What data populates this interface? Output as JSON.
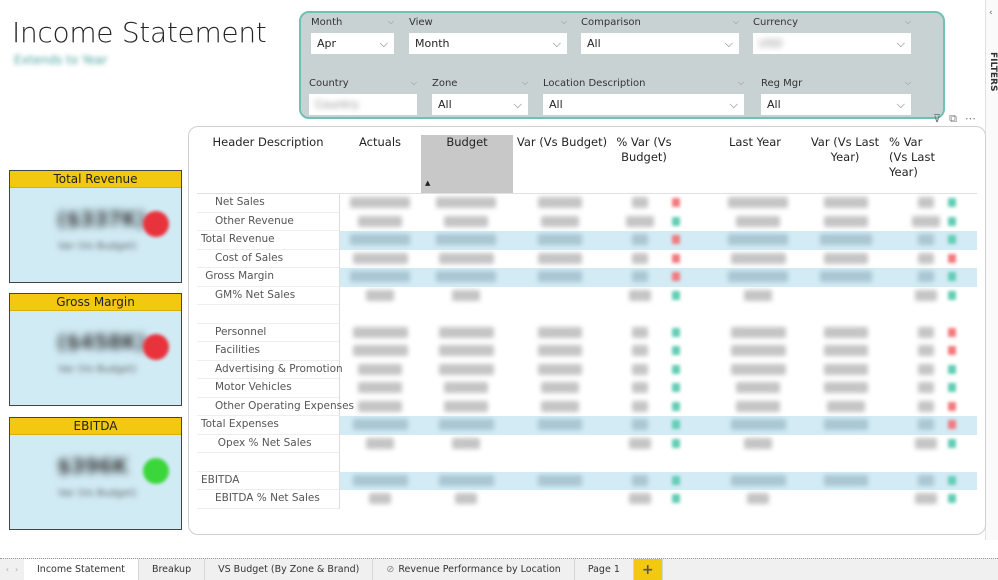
{
  "page": {
    "title": "Income Statement",
    "subtitle": "Extends to Year"
  },
  "slicers": [
    {
      "label": "Month",
      "value": "Apr"
    },
    {
      "label": "View",
      "value": "Month"
    },
    {
      "label": "Comparison",
      "value": "All"
    },
    {
      "label": "Currency",
      "value": "USD",
      "redacted": true
    },
    {
      "label": "Country",
      "value": "Country",
      "redacted": true
    },
    {
      "label": "Zone",
      "value": "All"
    },
    {
      "label": "Location Description",
      "value": "All"
    },
    {
      "label": "Reg Mgr",
      "value": "All"
    }
  ],
  "visual_header": {
    "filter_icon": "filter-icon",
    "focus_icon": "focus-mode-icon",
    "more_icon": "more-options-icon"
  },
  "filters_pane": {
    "label": "FILTERS"
  },
  "kpi_cards": [
    {
      "title": "Total Revenue",
      "value": "($337K)",
      "sub": "Var (Vs Budget)",
      "status": "negative",
      "status_color": "#e8323c"
    },
    {
      "title": "Gross Margin",
      "value": "($458K)",
      "sub": "Var (Vs Budget)",
      "status": "negative",
      "status_color": "#e8323c"
    },
    {
      "title": "EBITDA",
      "value": "$396K",
      "sub": "Var (Vs Budget)",
      "status": "positive",
      "status_color": "#3ad63a"
    }
  ],
  "matrix": {
    "columns": [
      "Header Description",
      "Actuals",
      "Budget",
      "Var (Vs Budget)",
      "% Var (Vs Budget)",
      "Last Year",
      "Var (Vs Last Year)",
      "% Var (Vs Last Year)"
    ],
    "sorted_column": "Budget",
    "sort_direction": "ascending",
    "rows": [
      {
        "label": "Net Sales",
        "level": 1,
        "highlight": false,
        "vals": [
          "$XX,XXX,XXX",
          "$XX,XXX,XXX",
          "$XXX,XXX",
          "X%",
          "$XX,XXX,XXX",
          "$XXX,XXX",
          "X%"
        ],
        "ind_budget": "down",
        "ind_ly": "up"
      },
      {
        "label": "Other Revenue",
        "level": 1,
        "highlight": false,
        "vals": [
          "$XXX,XXX",
          "$XXX,XXX",
          "$XX,XXX",
          "XX.X%",
          "$XXX,XXX",
          "$XXX,XXX",
          "XX.X%"
        ],
        "ind_budget": "up",
        "ind_ly": "up"
      },
      {
        "label": "Total Revenue",
        "level": 0,
        "highlight": true,
        "vals": [
          "$XX,XXX,XXX",
          "$XX,XXX,XXX",
          "$XXX,XXX",
          "X%",
          "$XX,XXX,XXX",
          "$X,XXX,XXX",
          "X%"
        ],
        "ind_budget": "down",
        "ind_ly": "up"
      },
      {
        "label": "Cost of Sales",
        "level": 1,
        "highlight": false,
        "vals": [
          "$X,XXX,XXX",
          "$X,XXX,XXX",
          "$XXX,XXX",
          "X%",
          "$X,XXX,XXX",
          "$XXX,XXX",
          "X%"
        ],
        "ind_budget": "down",
        "ind_ly": "down"
      },
      {
        "label": "Gross Margin",
        "level": 0.3,
        "highlight": true,
        "vals": [
          "$XX,XXX,XXX",
          "$XX,XXX,XXX",
          "$XXX,XXX",
          "X%",
          "$XX,XXX,XXX",
          "$X,XXX,XXX",
          "X%"
        ],
        "ind_budget": "down",
        "ind_ly": "up"
      },
      {
        "label": "GM% Net Sales",
        "level": 1,
        "highlight": false,
        "vals": [
          "XX.X%",
          "XX.X%",
          "",
          "X.X%",
          "XX.X%",
          "",
          "X.X%"
        ],
        "ind_budget": "up",
        "ind_ly": "up"
      },
      {
        "label": "",
        "level": 1,
        "highlight": false,
        "vals": [
          "",
          "",
          "",
          "",
          "",
          "",
          ""
        ],
        "ind_budget": "",
        "ind_ly": ""
      },
      {
        "label": "Personnel",
        "level": 1,
        "highlight": false,
        "vals": [
          "$X,XXX,XXX",
          "$X,XXX,XXX",
          "$XXX,XXX",
          "X%",
          "$X,XXX,XXX",
          "$XXX,XXX",
          "X%"
        ],
        "ind_budget": "up",
        "ind_ly": "down"
      },
      {
        "label": "Facilities",
        "level": 1,
        "highlight": false,
        "vals": [
          "$X,XXX,XXX",
          "$X,XXX,XXX",
          "$XXX,XXX",
          "X%",
          "$X,XXX,XXX",
          "$XXX,XXX",
          "X%"
        ],
        "ind_budget": "up",
        "ind_ly": "down"
      },
      {
        "label": "Advertising & Promotion",
        "level": 1,
        "highlight": false,
        "vals": [
          "$XXX,XXX",
          "$X,XXX,XXX",
          "$XXX,XXX",
          "XX%",
          "$X,XXX,XXX",
          "$XXX,XXX",
          "XX%"
        ],
        "ind_budget": "up",
        "ind_ly": "up"
      },
      {
        "label": "Motor Vehicles",
        "level": 1,
        "highlight": false,
        "vals": [
          "$XXX,XXX",
          "$XXX,XXX",
          "$XX,XXX",
          "XX%",
          "$XXX,XXX",
          "$XXX,XXX",
          "XX%"
        ],
        "ind_budget": "up",
        "ind_ly": "up"
      },
      {
        "label": "Other Operating Expenses",
        "level": 1,
        "highlight": false,
        "vals": [
          "$XXX,XXX",
          "$XXX,XXX",
          "$XX,XXX",
          "X%",
          "$XXX,XXX",
          "$XX,XXX",
          "X%"
        ],
        "ind_budget": "up",
        "ind_ly": "down"
      },
      {
        "label": "Total Expenses",
        "level": 0,
        "highlight": true,
        "vals": [
          "$X,XXX,XXX",
          "$X,XXX,XXX",
          "$XXX,XXX",
          "X%",
          "$X,XXX,XXX",
          "$XXX,XXX",
          "X%"
        ],
        "ind_budget": "up",
        "ind_ly": "down"
      },
      {
        "label": "Opex % Net Sales",
        "level": 1.2,
        "highlight": false,
        "vals": [
          "XX.X%",
          "XX.X%",
          "",
          "X.X%",
          "XX.X%",
          "",
          "X.X%"
        ],
        "ind_budget": "up",
        "ind_ly": "up"
      },
      {
        "label": "",
        "level": 1,
        "highlight": false,
        "vals": [
          "",
          "",
          "",
          "",
          "",
          "",
          ""
        ],
        "ind_budget": "",
        "ind_ly": ""
      },
      {
        "label": "EBITDA",
        "level": 0,
        "highlight": true,
        "vals": [
          "$X,XXX,XXX",
          "$X,XXX,XXX",
          "$XXX,XXX",
          "X%",
          "$X,XXX,XXX",
          "$XXX,XXX",
          "X%"
        ],
        "ind_budget": "up",
        "ind_ly": "up"
      },
      {
        "label": "EBITDA % Net Sales",
        "level": 1,
        "highlight": false,
        "vals": [
          "X.X%",
          "X.X%",
          "",
          "X.X%",
          "X.X%",
          "",
          "X.X%"
        ],
        "ind_budget": "up",
        "ind_ly": "up"
      }
    ],
    "indicator_colors": {
      "up": "#62cdb5",
      "down": "#f27a7e"
    },
    "redacted": true
  },
  "tabs": [
    {
      "label": "Income Statement",
      "active": true
    },
    {
      "label": "Breakup",
      "active": false
    },
    {
      "label": "VS Budget (By Zone & Brand)",
      "active": false
    },
    {
      "label": "Revenue Performance by Location",
      "active": false,
      "icon": "hidden-page-icon"
    },
    {
      "label": "Page 1",
      "active": false
    }
  ],
  "add_tab_label": "+"
}
